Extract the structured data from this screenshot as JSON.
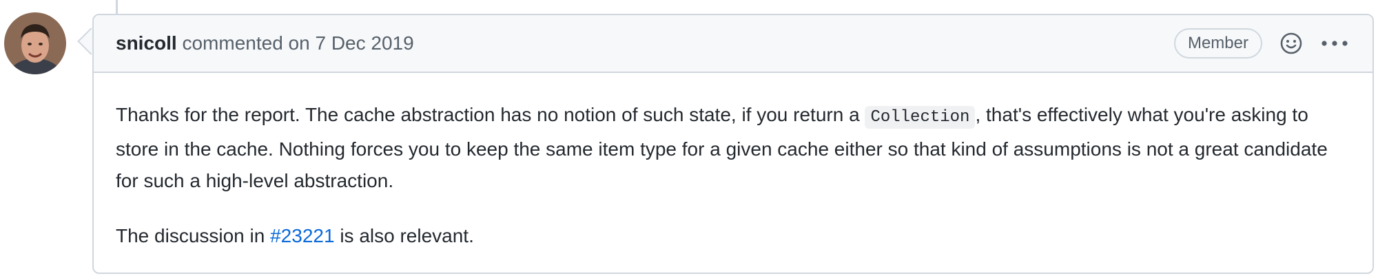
{
  "comment": {
    "author": "snicoll",
    "action_text": " commented on ",
    "date": "7 Dec 2019",
    "badge": "Member",
    "icons": {
      "avatar": "user-avatar",
      "reaction": "smiley-icon",
      "menu": "kebab-horizontal-icon"
    },
    "body": {
      "p1_before": "Thanks for the report. The cache abstraction has no notion of such state, if you return a ",
      "p1_code": "Collection",
      "p1_after": ", that's effectively what you're asking to store in the cache. Nothing forces you to keep the same item type for a given cache either so that kind of assumptions is not a great candidate for such a high-level abstraction.",
      "p2_before": "The discussion in ",
      "p2_link": "#23221",
      "p2_after": " is also relevant."
    }
  },
  "colors": {
    "link": "#0969da",
    "border": "#d0d7de",
    "header_bg": "#f6f8fa",
    "muted_text": "#57606a"
  }
}
